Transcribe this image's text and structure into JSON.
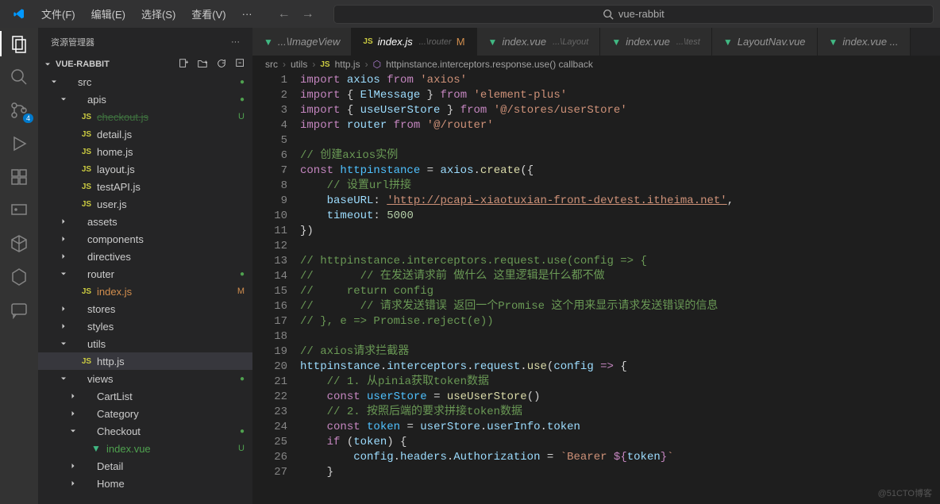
{
  "menu": {
    "file": "文件(F)",
    "edit": "编辑(E)",
    "select": "选择(S)",
    "view": "查看(V)",
    "more": "···"
  },
  "search": {
    "text": "vue-rabbit",
    "icon": "search-icon"
  },
  "sidebar": {
    "header": "资源管理器",
    "root": "VUE-RABBIT",
    "tree": [
      {
        "indent": 1,
        "type": "folder",
        "open": true,
        "name": "src",
        "status": "dot"
      },
      {
        "indent": 2,
        "type": "folder",
        "open": true,
        "name": "apis",
        "status": "dot"
      },
      {
        "indent": 3,
        "type": "file",
        "icon": "js",
        "name": "checkout.js",
        "status": "U",
        "color": "green",
        "partial": true
      },
      {
        "indent": 3,
        "type": "file",
        "icon": "js",
        "name": "detail.js"
      },
      {
        "indent": 3,
        "type": "file",
        "icon": "js",
        "name": "home.js"
      },
      {
        "indent": 3,
        "type": "file",
        "icon": "js",
        "name": "layout.js"
      },
      {
        "indent": 3,
        "type": "file",
        "icon": "js",
        "name": "testAPI.js"
      },
      {
        "indent": 3,
        "type": "file",
        "icon": "js",
        "name": "user.js"
      },
      {
        "indent": 2,
        "type": "folder",
        "open": false,
        "name": "assets"
      },
      {
        "indent": 2,
        "type": "folder",
        "open": false,
        "name": "components"
      },
      {
        "indent": 2,
        "type": "folder",
        "open": false,
        "name": "directives"
      },
      {
        "indent": 2,
        "type": "folder",
        "open": true,
        "name": "router",
        "status": "dot"
      },
      {
        "indent": 3,
        "type": "file",
        "icon": "js",
        "name": "index.js",
        "status": "M",
        "color": "orange"
      },
      {
        "indent": 2,
        "type": "folder",
        "open": false,
        "name": "stores"
      },
      {
        "indent": 2,
        "type": "folder",
        "open": false,
        "name": "styles"
      },
      {
        "indent": 2,
        "type": "folder",
        "open": true,
        "name": "utils"
      },
      {
        "indent": 3,
        "type": "file",
        "icon": "js",
        "name": "http.js",
        "selected": true
      },
      {
        "indent": 2,
        "type": "folder",
        "open": true,
        "name": "views",
        "status": "dot"
      },
      {
        "indent": 3,
        "type": "folder",
        "open": false,
        "name": "CartList"
      },
      {
        "indent": 3,
        "type": "folder",
        "open": false,
        "name": "Category"
      },
      {
        "indent": 3,
        "type": "folder",
        "open": true,
        "name": "Checkout",
        "status": "dot"
      },
      {
        "indent": 4,
        "type": "file",
        "icon": "vue",
        "name": "index.vue",
        "status": "U",
        "color": "green"
      },
      {
        "indent": 3,
        "type": "folder",
        "open": false,
        "name": "Detail"
      },
      {
        "indent": 3,
        "type": "folder",
        "open": false,
        "name": "Home"
      }
    ]
  },
  "tabs": [
    {
      "icon": "vue",
      "name": "...\\ImageView"
    },
    {
      "icon": "js",
      "name": "index.js",
      "sub": "...\\router",
      "status": "M",
      "active": true
    },
    {
      "icon": "vue",
      "name": "index.vue",
      "sub": "...\\Layout"
    },
    {
      "icon": "vue",
      "name": "index.vue",
      "sub": "...\\test"
    },
    {
      "icon": "vue",
      "name": "LayoutNav.vue"
    },
    {
      "icon": "vue",
      "name": "index.vue ..."
    }
  ],
  "breadcrumb": {
    "parts": [
      "src",
      "utils",
      "http.js",
      "httpinstance.interceptors.response.use() callback"
    ]
  },
  "code": [
    {
      "n": 1,
      "html": "<span class='kw'>import</span> <span class='var'>axios</span> <span class='kw'>from</span> <span class='str'>'axios'</span>"
    },
    {
      "n": 2,
      "html": "<span class='kw'>import</span> { <span class='var'>ElMessage</span> } <span class='kw'>from</span> <span class='str'>'element-plus'</span>"
    },
    {
      "n": 3,
      "html": "<span class='kw'>import</span> { <span class='var'>useUserStore</span> } <span class='kw'>from</span> <span class='str'>'@/stores/userStore'</span>"
    },
    {
      "n": 4,
      "html": "<span class='kw'>import</span> <span class='var'>router</span> <span class='kw'>from</span> <span class='str'>'@/router'</span>"
    },
    {
      "n": 5,
      "html": ""
    },
    {
      "n": 6,
      "html": "<span class='com'>// 创建axios实例</span>"
    },
    {
      "n": 7,
      "fold": true,
      "html": "<span class='kw'>const</span> <span class='typ'>httpinstance</span> <span class='op'>=</span> <span class='var'>axios</span>.<span class='fn'>create</span>({"
    },
    {
      "n": 8,
      "html": "    <span class='com'>// 设置url拼接</span>"
    },
    {
      "n": 9,
      "html": "    <span class='var'>baseURL</span>: <span class='str url'>'http://pcapi-xiaotuxian-front-devtest.itheima.net'</span>,"
    },
    {
      "n": 10,
      "html": "    <span class='var'>timeout</span>: <span class='num'>5000</span>"
    },
    {
      "n": 11,
      "html": "})"
    },
    {
      "n": 12,
      "html": ""
    },
    {
      "n": 13,
      "fold": true,
      "html": "<span class='com'>// httpinstance.interceptors.request.use(config =&gt; {</span>"
    },
    {
      "n": 14,
      "html": "<span class='com'>//       // 在发送请求前 做什么 这里逻辑是什么都不做</span>"
    },
    {
      "n": 15,
      "html": "<span class='com'>//     return config</span>"
    },
    {
      "n": 16,
      "html": "<span class='com'>//       // 请求发送错误 返回一个Promise 这个用来显示请求发送错误的信息</span>"
    },
    {
      "n": 17,
      "html": "<span class='com'>// }, e =&gt; Promise.reject(e))</span>"
    },
    {
      "n": 18,
      "html": ""
    },
    {
      "n": 19,
      "html": "<span class='com'>// axios请求拦截器</span>"
    },
    {
      "n": 20,
      "fold": true,
      "html": "<span class='var'>httpinstance</span>.<span class='var'>interceptors</span>.<span class='var'>request</span>.<span class='fn'>use</span>(<span class='var'>config</span> <span class='kw'>=&gt;</span> {"
    },
    {
      "n": 21,
      "html": "    <span class='com'>// 1. 从pinia获取token数据</span>"
    },
    {
      "n": 22,
      "html": "    <span class='kw'>const</span> <span class='typ'>userStore</span> <span class='op'>=</span> <span class='fn'>useUserStore</span>()"
    },
    {
      "n": 23,
      "html": "    <span class='com'>// 2. 按照后端的要求拼接token数据</span>"
    },
    {
      "n": 24,
      "html": "    <span class='kw'>const</span> <span class='typ'>token</span> <span class='op'>=</span> <span class='var'>userStore</span>.<span class='var'>userInfo</span>.<span class='var'>token</span>"
    },
    {
      "n": 25,
      "fold": true,
      "html": "    <span class='kw'>if</span> (<span class='var'>token</span>) {"
    },
    {
      "n": 26,
      "html": "        <span class='var'>config</span>.<span class='var'>headers</span>.<span class='var'>Authorization</span> <span class='op'>=</span> <span class='str'>`Bearer </span><span class='kw'>${</span><span class='var'>token</span><span class='kw'>}</span><span class='str'>`</span>"
    },
    {
      "n": 27,
      "html": "    }"
    }
  ],
  "watermark": "@51CTO博客"
}
